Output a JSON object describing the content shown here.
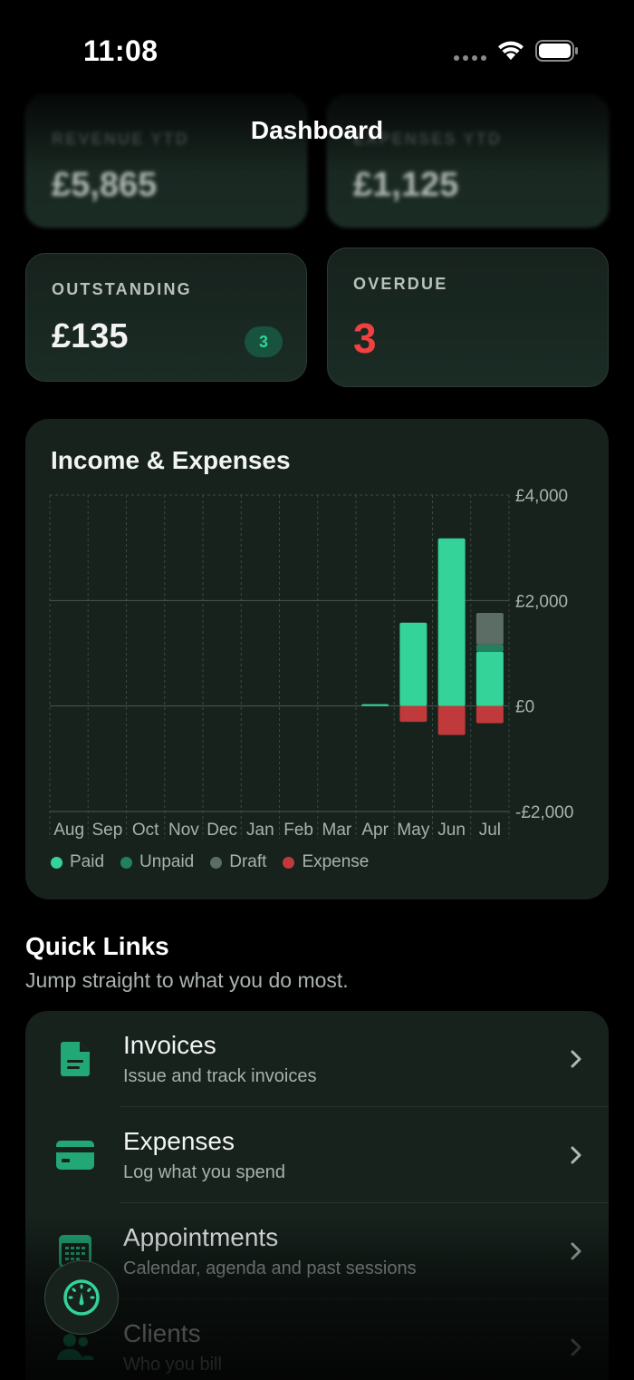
{
  "status_bar": {
    "time": "11:08"
  },
  "nav": {
    "title": "Dashboard"
  },
  "stats": {
    "revenue": {
      "label": "REVENUE YTD",
      "value": "£5,865"
    },
    "expenses": {
      "label": "EXPENSES YTD",
      "value": "£1,125"
    },
    "outstanding": {
      "label": "OUTSTANDING",
      "value": "£135",
      "badge": "3"
    },
    "overdue": {
      "label": "OVERDUE",
      "value": "3"
    }
  },
  "chart_data": {
    "type": "bar",
    "title": "Income & Expenses",
    "categories": [
      "Aug",
      "Sep",
      "Oct",
      "Nov",
      "Dec",
      "Jan",
      "Feb",
      "Mar",
      "Apr",
      "May",
      "Jun",
      "Jul"
    ],
    "series": [
      {
        "name": "Paid",
        "values": [
          0,
          0,
          0,
          0,
          0,
          0,
          0,
          0,
          30,
          1580,
          3180,
          1030
        ],
        "color": "#34d399"
      },
      {
        "name": "Unpaid",
        "values": [
          0,
          0,
          0,
          0,
          0,
          0,
          0,
          0,
          0,
          0,
          0,
          135
        ],
        "color": "#22805f"
      },
      {
        "name": "Draft",
        "values": [
          0,
          0,
          0,
          0,
          0,
          0,
          0,
          0,
          0,
          0,
          0,
          600
        ],
        "color": "#5b6d64"
      },
      {
        "name": "Expense",
        "values": [
          0,
          0,
          0,
          0,
          0,
          0,
          0,
          0,
          0,
          -300,
          -550,
          -325
        ],
        "color": "#c0393b"
      }
    ],
    "y_ticks": [
      "£4,000",
      "£2,000",
      "£0",
      "-£2,000"
    ],
    "ylim": [
      -2000,
      4000
    ],
    "stacked": true,
    "grid": true,
    "legend_position": "bottom"
  },
  "quick_links": {
    "title": "Quick Links",
    "subtitle": "Jump straight to what you do most.",
    "items": [
      {
        "title": "Invoices",
        "subtitle": "Issue and track invoices",
        "icon": "document-icon"
      },
      {
        "title": "Expenses",
        "subtitle": "Log what you spend",
        "icon": "card-icon"
      },
      {
        "title": "Appointments",
        "subtitle": "Calendar, agenda and past sessions",
        "icon": "calendar-icon"
      },
      {
        "title": "Clients",
        "subtitle": "Who you bill",
        "icon": "people-icon"
      }
    ]
  },
  "colors": {
    "accent": "#34d399",
    "danger": "#f0413f",
    "background": "#000000",
    "card": "#17221d"
  }
}
